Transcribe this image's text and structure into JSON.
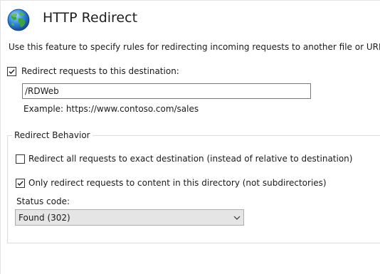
{
  "header": {
    "title": "HTTP Redirect",
    "icon": "globe-icon"
  },
  "description": "Use this feature to specify rules for redirecting incoming requests to another file or URL.",
  "redirect_destination": {
    "checkbox_label": "Redirect requests to this destination:",
    "checked": true,
    "value": "/RDWeb",
    "example": "Example: https://www.contoso.com/sales"
  },
  "redirect_behavior": {
    "group_label": "Redirect Behavior",
    "exact_destination": {
      "label": "Redirect all requests to exact destination (instead of relative to destination)",
      "checked": false
    },
    "only_this_directory": {
      "label": "Only redirect requests to content in this directory (not subdirectories)",
      "checked": true
    },
    "status_code": {
      "label": "Status code:",
      "selected": "Found (302)"
    }
  },
  "colors": {
    "checkmark": "#1a1a1a",
    "dropdown_background": "#e5e5e5",
    "input_border": "#7a7a7a"
  }
}
